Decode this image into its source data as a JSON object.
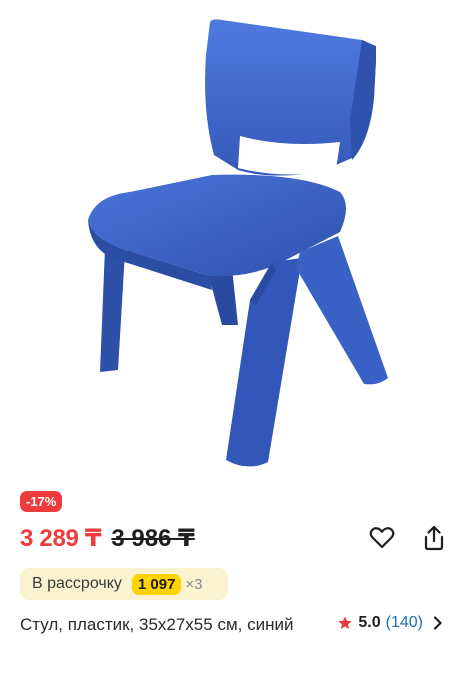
{
  "product": {
    "image_alt": "blue plastic chair",
    "discount_badge": "-17%",
    "price_current": "3 289 ₸",
    "price_old": "3 986 ₸",
    "installment": {
      "label": "В рассрочку",
      "amount": "1 097",
      "times": "×3"
    },
    "title": "Стул, пластик, 35x27x55 см, синий",
    "rating": {
      "value": "5.0",
      "count": "(140)"
    }
  },
  "actions": {
    "favorite_icon": "heart-icon",
    "share_icon": "share-icon"
  },
  "colors": {
    "accent_red": "#ee3b3b",
    "installment_bg": "#fbf3cf",
    "installment_amount_bg": "#ffd400",
    "rating_link": "#1f6fb5",
    "chair_blue": "#3b63c9"
  }
}
